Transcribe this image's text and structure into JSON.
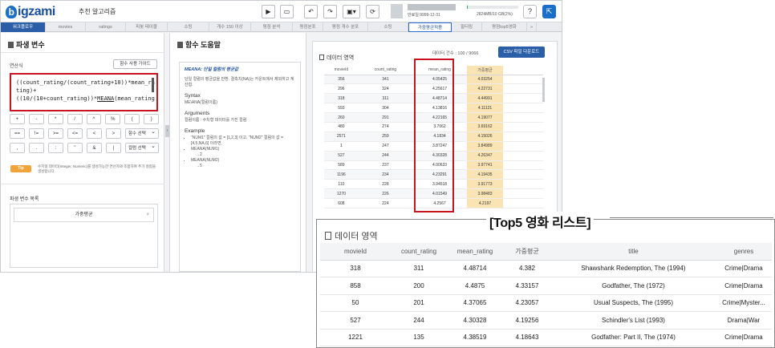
{
  "header": {
    "logo_text": "igzami",
    "logo_b": "b",
    "app_name": "추천 알고리즘",
    "user_date": "만료일:9999-12-31",
    "storage_text": "2824MB/10 GB(2%)",
    "storage_pct": 2
  },
  "tabs": [
    "워크플로우",
    "movies",
    "ratings",
    "피봇 테이블",
    "소팅",
    "개수 150 이상",
    "평점 분석",
    "평점분포",
    "평점 개수 분포",
    "소팅",
    "가중평균적용",
    "필터링",
    "평점top5영화"
  ],
  "left_panel": {
    "title": "파생 변수",
    "formula_label": "연산식",
    "guide_button": "함수 사용 가이드",
    "formula_lines": [
      "((count_rating/(count_rating+10))*mean_ra",
      "ting)+",
      "((10/(10+count_rating))*",
      "MEANA",
      "(mean_rating"
    ],
    "keys_row1": [
      "+",
      "-",
      "*",
      "/",
      "^",
      "%",
      "(",
      ")"
    ],
    "keys_row2": [
      "==",
      "!=",
      ">=",
      "<=",
      "<",
      ">"
    ],
    "func_select": "함수 선택",
    "keys_row3": [
      ",",
      ".",
      ":",
      "\"",
      "&",
      "|"
    ],
    "col_select": "컬럼 선택",
    "tip_label": "Tip",
    "tip_text": "수치형 데이터(Integer, Numeric)를 생성가능한 연산자와 조합하여 추가 컬럼을 생성합니다.",
    "var_list_label": "파생 변수 목록",
    "var_item": "가중평균",
    "var_item_close": "×"
  },
  "mid_panel": {
    "title": "함수 도움말",
    "func_name": "MEANA: 단일 컬럼의 평균값",
    "func_desc": "단일 컬럼의 평균값을 반환. 결측치(NA)는 카운트에서 제외하고 계산함.",
    "syntax_label": "Syntax",
    "syntax": "ME\\ANA(컬럼이름)",
    "args_label": "Arguments",
    "args": "컬럼이름 : 수치형 데이터를 가진 컬럼",
    "example_label": "Example",
    "ex1": "\"NUM1\" 컬럼의 값 = [1,2,3] 이고, \"NUM2\" 컬럼의 값 = [4,5,NA,6] 이라면,",
    "ex2": "MEANA(NUM1)",
    "ex3": "→2",
    "ex4": "MEANA(NUM2)",
    "ex5": "→5"
  },
  "right_panel": {
    "title": "데이터 영역",
    "count_text": "데이터 건수 : 100 / 9066",
    "csv_button": "CSV 파일 다운로드",
    "columns": [
      "movieId",
      "count_rating",
      "mean_rating",
      "가중평균"
    ],
    "rows": [
      [
        "356",
        "341",
        "4.05425",
        "4.03254"
      ],
      [
        "296",
        "324",
        "4.25617",
        "4.22731"
      ],
      [
        "318",
        "311",
        "4.48714",
        "4.44991"
      ],
      [
        "593",
        "304",
        "4.13816",
        "4.11121"
      ],
      [
        "260",
        "291",
        "4.22165",
        "4.19077"
      ],
      [
        "480",
        "274",
        "3.7062",
        "3.69162"
      ],
      [
        "2571",
        "259",
        "4.1834",
        "4.15026"
      ],
      [
        "1",
        "247",
        "3.87247",
        "3.84989"
      ],
      [
        "527",
        "244",
        "4.30328",
        "4.26347"
      ],
      [
        "589",
        "237",
        "4.00633",
        "3.97741"
      ],
      [
        "1196",
        "234",
        "4.23291",
        "4.19435"
      ],
      [
        "110",
        "228",
        "3.94518",
        "3.91773"
      ],
      [
        "1270",
        "226",
        "4.01549",
        "3.98483"
      ],
      [
        "608",
        "224",
        "4.2567",
        "4.2197"
      ]
    ]
  },
  "callout": {
    "title": "[Top5 영화 리스트]",
    "subtitle": "데이터 영역",
    "columns": [
      "movieId",
      "count_rating",
      "mean_rating",
      "가중평균",
      "title",
      "genres"
    ],
    "rows": [
      [
        "318",
        "311",
        "4.48714",
        "4.382",
        "Shawshank Redemption, The (1994)",
        "Crime|Drama"
      ],
      [
        "858",
        "200",
        "4.4875",
        "4.33157",
        "Godfather, The (1972)",
        "Crime|Drama"
      ],
      [
        "50",
        "201",
        "4.37065",
        "4.23057",
        "Usual Suspects, The (1995)",
        "Crime|Myster..."
      ],
      [
        "527",
        "244",
        "4.30328",
        "4.19256",
        "Schindler's List (1993)",
        "Drama|War"
      ],
      [
        "1221",
        "135",
        "4.38519",
        "4.18643",
        "Godfather: Part II, The (1974)",
        "Crime|Drama"
      ]
    ]
  }
}
